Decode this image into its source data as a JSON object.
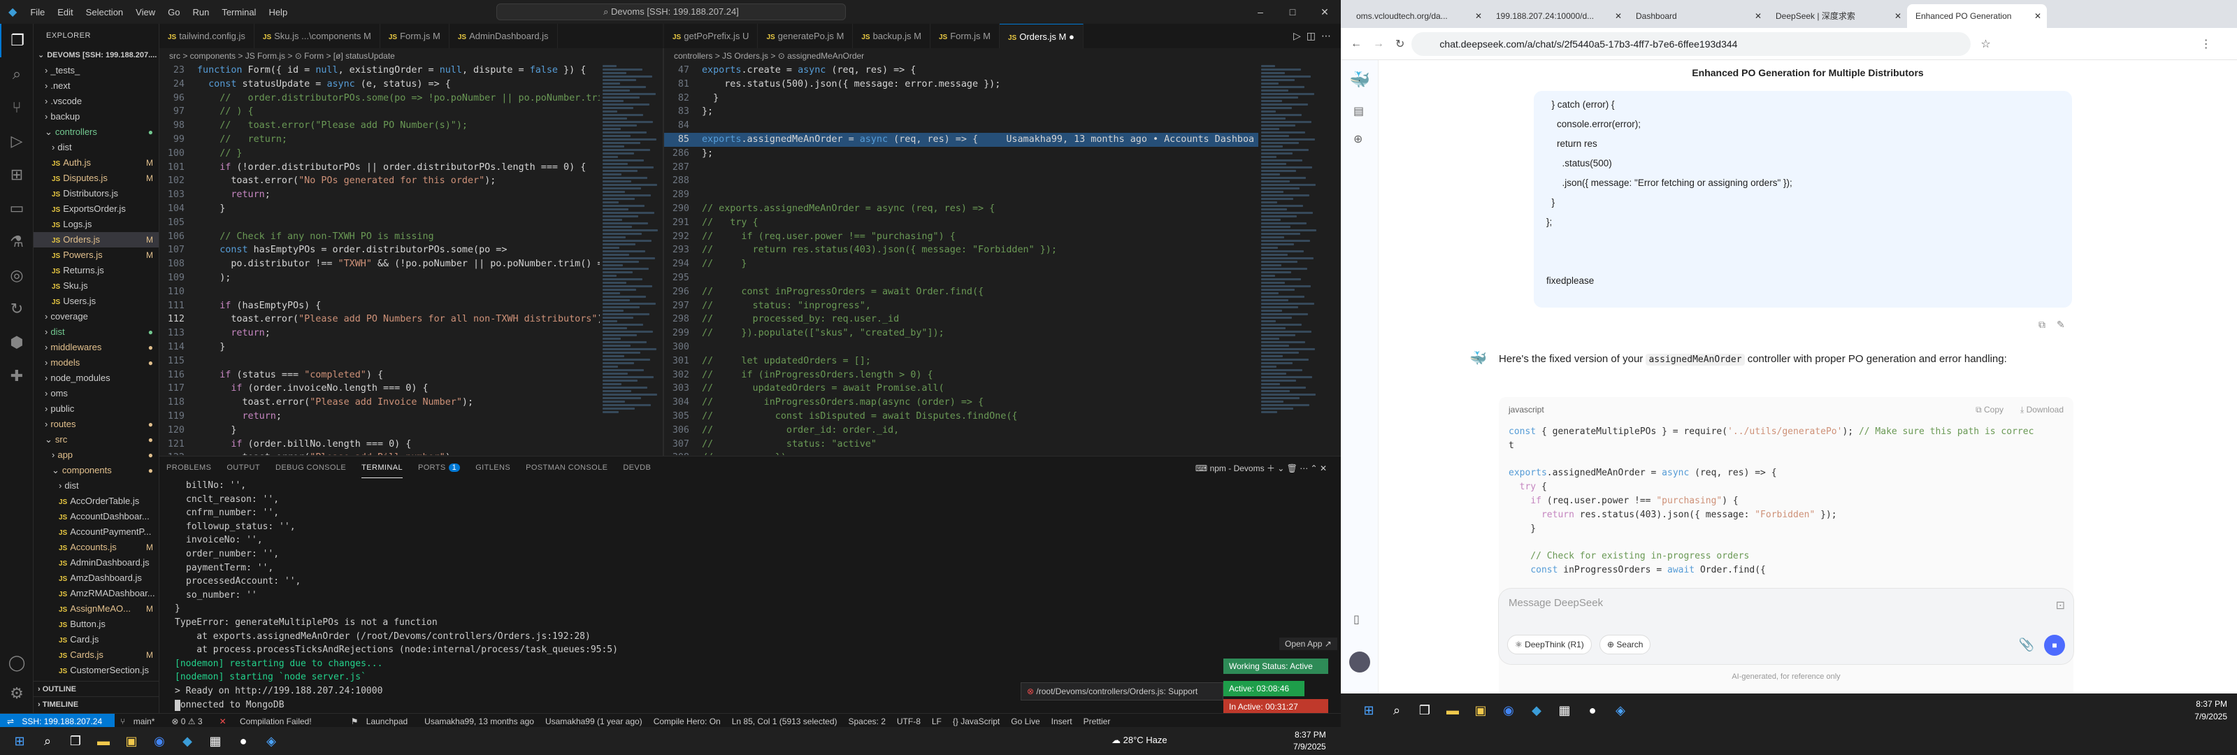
{
  "vscode": {
    "menu": [
      "File",
      "Edit",
      "Selection",
      "View",
      "Go",
      "Run",
      "Terminal",
      "Help"
    ],
    "search": "Devoms [SSH: 199.188.207.24]",
    "explorer_title": "EXPLORER",
    "root": "DEVOMS [SSH: 199.188.207....",
    "tree": [
      {
        "label": "_tests_",
        "type": "folder",
        "indent": 1
      },
      {
        "label": ".next",
        "type": "folder",
        "indent": 1
      },
      {
        "label": ".vscode",
        "type": "folder",
        "indent": 1
      },
      {
        "label": "backup",
        "type": "folder",
        "indent": 1
      },
      {
        "label": "controllers",
        "type": "folder-open",
        "indent": 1,
        "badge": "●",
        "color": "#73c991"
      },
      {
        "label": "dist",
        "type": "folder",
        "indent": 2
      },
      {
        "label": "Auth.js",
        "type": "js",
        "indent": 2,
        "badge": "M",
        "color": "#e2c08d"
      },
      {
        "label": "Disputes.js",
        "type": "js",
        "indent": 2,
        "badge": "M",
        "color": "#e2c08d"
      },
      {
        "label": "Distributors.js",
        "type": "js",
        "indent": 2
      },
      {
        "label": "ExportsOrder.js",
        "type": "js",
        "indent": 2
      },
      {
        "label": "Logs.js",
        "type": "js",
        "indent": 2
      },
      {
        "label": "Orders.js",
        "type": "js",
        "indent": 2,
        "badge": "M",
        "color": "#e2c08d",
        "sel": true
      },
      {
        "label": "Powers.js",
        "type": "js",
        "indent": 2,
        "badge": "M",
        "color": "#e2c08d"
      },
      {
        "label": "Returns.js",
        "type": "js",
        "indent": 2
      },
      {
        "label": "Sku.js",
        "type": "js",
        "indent": 2
      },
      {
        "label": "Users.js",
        "type": "js",
        "indent": 2
      },
      {
        "label": "coverage",
        "type": "folder",
        "indent": 1
      },
      {
        "label": "dist",
        "type": "folder",
        "indent": 1,
        "badge": "●",
        "color": "#73c991"
      },
      {
        "label": "middlewares",
        "type": "folder",
        "indent": 1,
        "badge": "●",
        "color": "#e2c08d"
      },
      {
        "label": "models",
        "type": "folder",
        "indent": 1,
        "badge": "●",
        "color": "#e2c08d"
      },
      {
        "label": "node_modules",
        "type": "folder",
        "indent": 1
      },
      {
        "label": "oms",
        "type": "folder",
        "indent": 1
      },
      {
        "label": "public",
        "type": "folder",
        "indent": 1
      },
      {
        "label": "routes",
        "type": "folder",
        "indent": 1,
        "badge": "●",
        "color": "#e2c08d"
      },
      {
        "label": "src",
        "type": "folder-open",
        "indent": 1,
        "badge": "●",
        "color": "#e2c08d"
      },
      {
        "label": "app",
        "type": "folder",
        "indent": 2,
        "badge": "●",
        "color": "#e2c08d"
      },
      {
        "label": "components",
        "type": "folder-open",
        "indent": 2,
        "badge": "●",
        "color": "#e2c08d"
      },
      {
        "label": "dist",
        "type": "folder",
        "indent": 3
      },
      {
        "label": "AccOrderTable.js",
        "type": "js",
        "indent": 3
      },
      {
        "label": "AccountDashboar...",
        "type": "js",
        "indent": 3
      },
      {
        "label": "AccountPaymentP...",
        "type": "js",
        "indent": 3
      },
      {
        "label": "Accounts.js",
        "type": "js",
        "indent": 3,
        "badge": "M",
        "color": "#e2c08d"
      },
      {
        "label": "AdminDashboard.js",
        "type": "js",
        "indent": 3
      },
      {
        "label": "AmzDashboard.js",
        "type": "js",
        "indent": 3
      },
      {
        "label": "AmzRMADashboar...",
        "type": "js",
        "indent": 3
      },
      {
        "label": "AssignMeAO...",
        "type": "js",
        "indent": 3,
        "badge": "M",
        "color": "#e2c08d"
      },
      {
        "label": "Button.js",
        "type": "js",
        "indent": 3
      },
      {
        "label": "Card.js",
        "type": "js",
        "indent": 3
      },
      {
        "label": "Cards.js",
        "type": "js",
        "indent": 3,
        "badge": "M",
        "color": "#e2c08d"
      },
      {
        "label": "CustomerSection.js",
        "type": "js",
        "indent": 3
      }
    ],
    "outline": "OUTLINE",
    "timeline": "TIMELINE",
    "tabs1": [
      {
        "label": "tailwind.config.js"
      },
      {
        "label": "Sku.js ...\\components M"
      },
      {
        "label": "Form.js M"
      },
      {
        "label": "AdminDashboard.js"
      }
    ],
    "tabs2": [
      {
        "label": "getPoPrefix.js U"
      },
      {
        "label": "generatePo.js M"
      },
      {
        "label": "backup.js M"
      },
      {
        "label": "Form.js M"
      },
      {
        "label": "Orders.js M ●",
        "on": true
      }
    ],
    "crumbs1": "src > components > JS Form.js > ⊙ Form > [ø] statusUpdate",
    "crumbs2": "controllers > JS Orders.js > ⊙ assignedMeAnOrder",
    "editor1": [
      [
        23,
        "function Form({ id = null, existingOrder = null, dispute = false }) {"
      ],
      [
        24,
        "  const statusUpdate = async (e, status) => {"
      ],
      [
        96,
        "    //   order.distributorPOs.some(po => !po.poNumber || po.poNumber.trim"
      ],
      [
        97,
        "    // ) {"
      ],
      [
        98,
        "    //   toast.error(\"Please add PO Number(s)\");"
      ],
      [
        99,
        "    //   return;"
      ],
      [
        100,
        "    // }"
      ],
      [
        101,
        "    if (!order.distributorPOs || order.distributorPOs.length === 0) {"
      ],
      [
        102,
        "      toast.error(\"No POs generated for this order\");"
      ],
      [
        103,
        "      return;"
      ],
      [
        104,
        "    }"
      ],
      [
        105,
        ""
      ],
      [
        106,
        "    // Check if any non-TXWH PO is missing"
      ],
      [
        107,
        "    const hasEmptyPOs = order.distributorPOs.some(po =>"
      ],
      [
        108,
        "      po.distributor !== \"TXWH\" && (!po.poNumber || po.poNumber.trim() ="
      ],
      [
        109,
        "    );"
      ],
      [
        110,
        ""
      ],
      [
        111,
        "    if (hasEmptyPOs) {"
      ],
      [
        112,
        "      toast.error(\"Please add PO Numbers for all non-TXWH distributors\")"
      ],
      [
        113,
        "      return;"
      ],
      [
        114,
        "    }"
      ],
      [
        115,
        ""
      ],
      [
        116,
        "    if (status === \"completed\") {"
      ],
      [
        117,
        "      if (order.invoiceNo.length === 0) {"
      ],
      [
        118,
        "        toast.error(\"Please add Invoice Number\");"
      ],
      [
        119,
        "        return;"
      ],
      [
        120,
        "      }"
      ],
      [
        121,
        "      if (order.billNo.length === 0) {"
      ],
      [
        122,
        "        toast.error(\"Please add Bill number\");"
      ]
    ],
    "editor2": [
      [
        47,
        "exports.create = async (req, res) => {"
      ],
      [
        81,
        "    res.status(500).json({ message: error.message });"
      ],
      [
        82,
        "  }"
      ],
      [
        83,
        "};"
      ],
      [
        84,
        ""
      ],
      [
        85,
        "exports.assignedMeAnOrder = async (req, res) => {     Usamakha99, 13 months ago • Accounts Dashboa"
      ],
      [
        286,
        "};"
      ],
      [
        287,
        ""
      ],
      [
        288,
        ""
      ],
      [
        289,
        ""
      ],
      [
        290,
        "// exports.assignedMeAnOrder = async (req, res) => {"
      ],
      [
        291,
        "//   try {"
      ],
      [
        292,
        "//     if (req.user.power !== \"purchasing\") {"
      ],
      [
        293,
        "//       return res.status(403).json({ message: \"Forbidden\" });"
      ],
      [
        294,
        "//     }"
      ],
      [
        295,
        ""
      ],
      [
        296,
        "//     const inProgressOrders = await Order.find({"
      ],
      [
        297,
        "//       status: \"inprogress\","
      ],
      [
        298,
        "//       processed_by: req.user._id"
      ],
      [
        299,
        "//     }).populate([\"skus\", \"created_by\"]);"
      ],
      [
        300,
        ""
      ],
      [
        301,
        "//     let updatedOrders = [];"
      ],
      [
        302,
        "//     if (inProgressOrders.length > 0) {"
      ],
      [
        303,
        "//       updatedOrders = await Promise.all("
      ],
      [
        304,
        "//         inProgressOrders.map(async (order) => {"
      ],
      [
        305,
        "//           const isDisputed = await Disputes.findOne({"
      ],
      [
        306,
        "//             order_id: order._id,"
      ],
      [
        307,
        "//             status: \"active\""
      ],
      [
        308,
        "//           });"
      ]
    ],
    "panel_tabs": [
      "PROBLEMS",
      "OUTPUT",
      "DEBUG CONSOLE",
      "TERMINAL",
      "PORTS",
      "GITLENS",
      "POSTMAN CONSOLE",
      "DEVDB"
    ],
    "ports_count": "1",
    "terminal_name": "npm - Devoms",
    "terminal": [
      "billNo: '',",
      "cnclt_reason: '',",
      "cnfrm_number: '',",
      "followup_status: '',",
      "invoiceNo: '',",
      "order_number: '',",
      "paymentTerm: '',",
      "processedAccount: '',",
      "so_number: ''",
      "}",
      "TypeError: generateMultiplePOs is not a function",
      "    at exports.assignedMeAnOrder (/root/Devoms/controllers/Orders.js:192:28)",
      "    at process.processTicksAndRejections (node:internal/process/task_queues:95:5)",
      "[nodemon] restarting due to changes...",
      "[nodemon] starting `node server.js`",
      "> Ready on http://199.188.207.24:10000",
      "Connected to MongoDB"
    ],
    "open_app": "Open App ↗",
    "notif": "/root/Devoms/controllers/Orders.js: Support",
    "working_status": "Working Status: Active",
    "active_time": "Active: 03:08:46",
    "inactive_time": "In Active: 00:31:27",
    "status": {
      "remote": "SSH: 199.188.207.24",
      "branch": "main*",
      "sync": "⊗ 0 ⚠ 3",
      "compile": "Compilation Failed!",
      "launchpad": "Launchpad",
      "blame1": "Usamakha99, 13 months ago",
      "blame2": "Usamakha99 (1 year ago)",
      "compile_hero": "Compile Hero: On",
      "pos": "Ln 85, Col 1 (5913 selected)",
      "spaces": "Spaces: 2",
      "enc": "UTF-8",
      "eol": "LF",
      "lang": "{} JavaScript",
      "golive": "Go Live",
      "insert": "Insert",
      "prettier": "Prettier"
    }
  },
  "chrome": {
    "tabs": [
      {
        "label": "oms.vcloudtech.org/da..."
      },
      {
        "label": "199.188.207.24:10000/d..."
      },
      {
        "label": "Dashboard"
      },
      {
        "label": "DeepSeek | 深度求索"
      },
      {
        "label": "Enhanced PO Generation",
        "on": true
      }
    ],
    "url": "chat.deepseek.com/a/chat/s/2f5440a5-17b3-4ff7-b7e6-6ffee193d344",
    "chat_title": "Enhanced PO Generation for Multiple Distributors",
    "user_lines": [
      "  } catch (error) {",
      "    console.error(error);",
      "    return res",
      "      .status(500)",
      "      .json({ message: \"Error fetching or assigning orders\" });",
      "  }",
      "};",
      "",
      "",
      "fixedplease"
    ],
    "reply": "Here's the fixed version of your",
    "reply_code_word": "assignedMeAnOrder",
    "reply_rest": "controller with proper PO generation and error handling:",
    "lang": "javascript",
    "copy": "Copy",
    "download": "Download",
    "code": [
      "const { generateMultiplePOs } = require('../utils/generatePo'); // Make sure this path is correc",
      "t",
      "",
      "exports.assignedMeAnOrder = async (req, res) => {",
      "  try {",
      "    if (req.user.power !== \"purchasing\") {",
      "      return res.status(403).json({ message: \"Forbidden\" });",
      "    }",
      "",
      "    // Check for existing in-progress orders",
      "    const inProgressOrders = await Order.find({"
    ],
    "placeholder": "Message DeepSeek",
    "deepthink": "DeepThink (R1)",
    "search": "Search",
    "footer": "AI-generated, for reference only"
  },
  "taskbar": {
    "weather": "28°C Haze",
    "time": "8:37 PM",
    "date": "7/9/2025",
    "time2": "8:37 PM",
    "date2": "7/9/2025"
  }
}
